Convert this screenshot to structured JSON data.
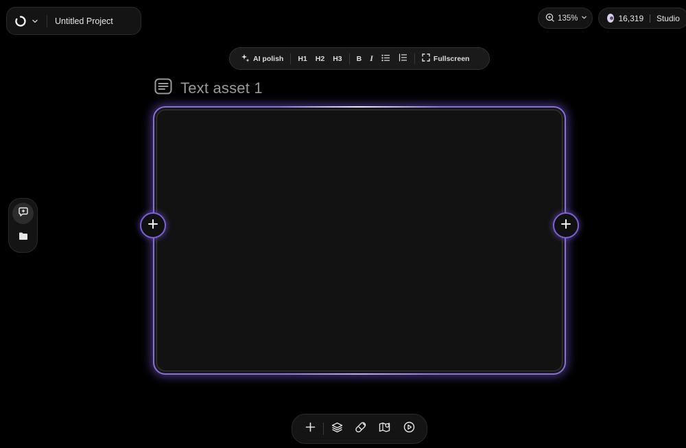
{
  "project": {
    "name": "Untitled Project",
    "logo_icon": "swirl-logo-icon",
    "menu_icon": "chevron-down-icon"
  },
  "zoom": {
    "label": "135%",
    "icon": "zoom-icon"
  },
  "credits": {
    "amount": "16,319",
    "plan": "Studio",
    "icon": "credits-icon"
  },
  "toolbar": {
    "ai_polish": "AI polish",
    "h1": "H1",
    "h2": "H2",
    "h3": "H3",
    "bold": "B",
    "italic": "I",
    "fullscreen": "Fullscreen"
  },
  "asset": {
    "title": "Text asset 1",
    "icon": "text-document-icon"
  },
  "side_panel": {
    "items": [
      "chat-icon",
      "folder-icon"
    ]
  },
  "bottom_bar": {
    "items": [
      "plus-icon",
      "layers-icon",
      "magnet-icon",
      "map-icon",
      "play-icon"
    ]
  },
  "colors": {
    "accent": "#8a6fd6",
    "background": "#000000",
    "canvas": "#121212"
  }
}
